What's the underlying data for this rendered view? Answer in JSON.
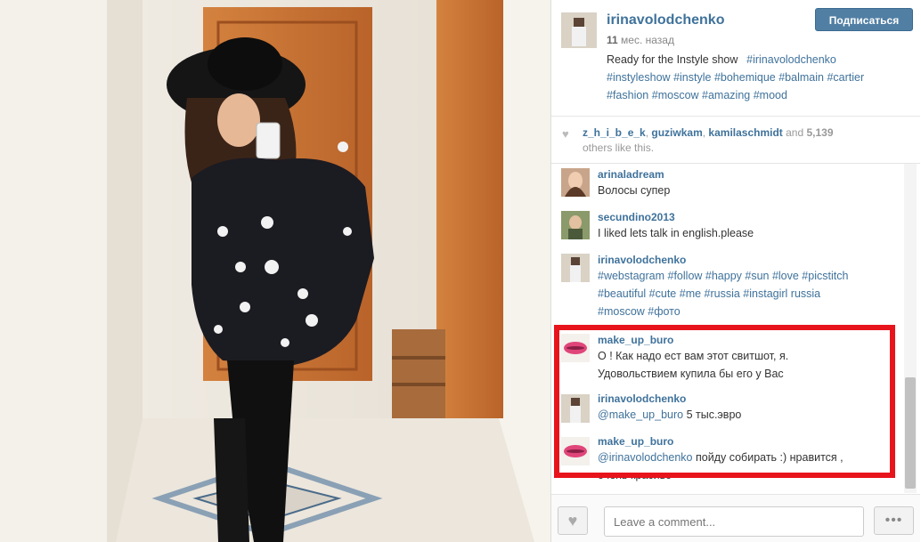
{
  "post": {
    "username": "irinavolodchenko",
    "time_value": "11",
    "time_unit": "мес. назад",
    "follow_label": "Подписаться",
    "caption_lines": [
      "Ready for the Instyle show  #irinavolodchenko",
      "#instyleshow #instyle #bohemique #balmain #cartier",
      "#fashion #moscow #amazing #mood"
    ]
  },
  "likes": {
    "user1": "z_h_i_b_e_k",
    "sep1": ", ",
    "user2": "guziwkam",
    "sep2": ", ",
    "user3": "kamilaschmidt",
    "and": " and ",
    "count": "5,139",
    "rest": "others like this."
  },
  "comments": [
    {
      "user": "arinaladream",
      "text": "Волосы супер"
    },
    {
      "user": "secundino2013",
      "text": "I liked lets talk in english.please"
    },
    {
      "user": "irinavolodchenko",
      "lines": [
        "#webstagram #follow #happy #sun #love #picstitch",
        "#beautiful #cute #me #russia #instagirl  russia",
        "#moscow #фото"
      ]
    },
    {
      "user": "make_up_buro",
      "lines": [
        "О ! Как надо ест вам этот свитшот, я.",
        "Удовольствием купила бы его у Вас"
      ]
    },
    {
      "user": "irinavolodchenko",
      "mention": "@make_up_buro",
      "text": " 5 тыс.эвро"
    },
    {
      "user": "make_up_buro",
      "mention": "@irinavolodchenko",
      "lines": [
        " пойду собирать :) нравится ,",
        "очень красиво"
      ]
    }
  ],
  "footer": {
    "comment_placeholder": "Leave a comment...",
    "more_label": "•••"
  },
  "icons": {
    "heart": "heart-icon",
    "more": "more-options-icon"
  },
  "colors": {
    "link_blue": "#3f729b",
    "button_blue": "#517fa4",
    "highlight_red": "#e8141c"
  }
}
